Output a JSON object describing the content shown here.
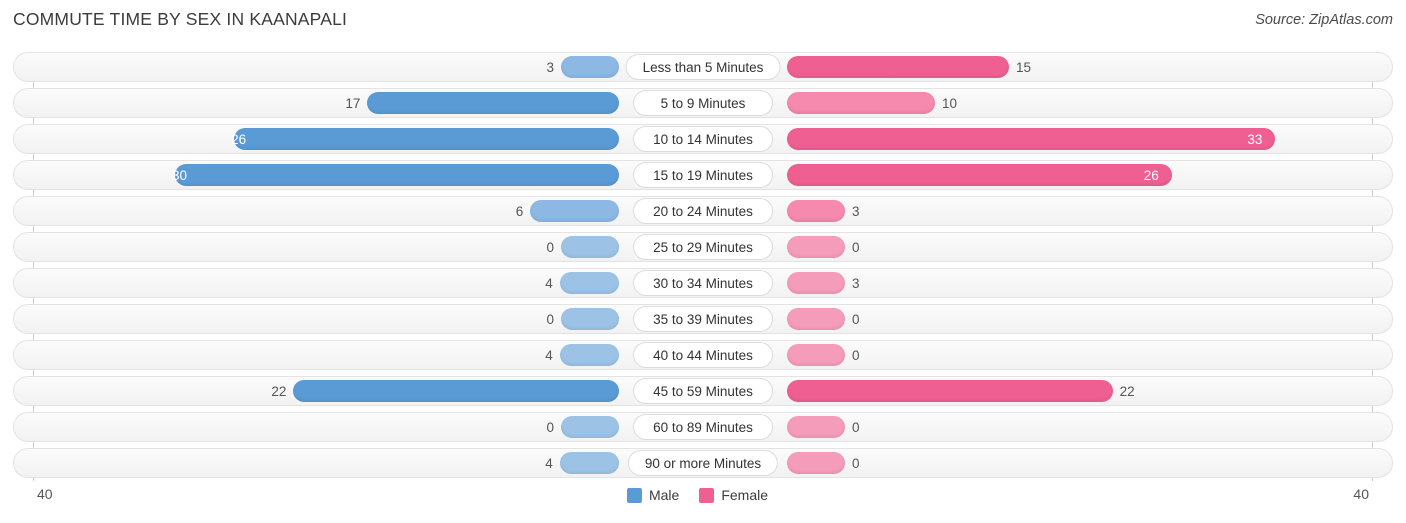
{
  "header": {
    "title": "COMMUTE TIME BY SEX IN KAANAPALI",
    "source": "Source: ZipAtlas.com"
  },
  "axis": {
    "left_label": "40",
    "right_label": "40",
    "max": 40
  },
  "legend": {
    "items": [
      {
        "label": "Male",
        "color": "#5b9bd5"
      },
      {
        "label": "Female",
        "color": "#ef5f92"
      }
    ]
  },
  "chart_data": {
    "type": "bar",
    "orientation": "horizontal-diverging",
    "title": "COMMUTE TIME BY SEX IN KAANAPALI",
    "xlabel": "",
    "ylabel": "",
    "xlim": [
      40,
      40
    ],
    "grid": false,
    "legend_position": "bottom-center",
    "categories": [
      "Less than 5 Minutes",
      "5 to 9 Minutes",
      "10 to 14 Minutes",
      "15 to 19 Minutes",
      "20 to 24 Minutes",
      "25 to 29 Minutes",
      "30 to 34 Minutes",
      "35 to 39 Minutes",
      "40 to 44 Minutes",
      "45 to 59 Minutes",
      "60 to 89 Minutes",
      "90 or more Minutes"
    ],
    "series": [
      {
        "name": "Male",
        "color": "#5b9bd5",
        "values": [
          3,
          17,
          26,
          30,
          6,
          0,
          4,
          0,
          4,
          22,
          0,
          4
        ]
      },
      {
        "name": "Female",
        "color": "#ef5f92",
        "values": [
          15,
          10,
          33,
          26,
          3,
          0,
          3,
          0,
          0,
          22,
          0,
          0
        ]
      }
    ]
  },
  "rows": [
    {
      "category": "Less than 5 Minutes",
      "male": "3",
      "female": "15",
      "male_val": 3,
      "female_val": 15,
      "male_shade": "mid",
      "female_shade": "sat",
      "male_inside": false,
      "female_inside": false
    },
    {
      "category": "5 to 9 Minutes",
      "male": "17",
      "female": "10",
      "male_val": 17,
      "female_val": 10,
      "male_shade": "sat",
      "female_shade": "mid",
      "male_inside": false,
      "female_inside": false
    },
    {
      "category": "10 to 14 Minutes",
      "male": "26",
      "female": "33",
      "male_val": 26,
      "female_val": 33,
      "male_shade": "sat",
      "female_shade": "sat",
      "male_inside": true,
      "female_inside": true
    },
    {
      "category": "15 to 19 Minutes",
      "male": "30",
      "female": "26",
      "male_val": 30,
      "female_val": 26,
      "male_shade": "sat",
      "female_shade": "sat",
      "male_inside": true,
      "female_inside": true
    },
    {
      "category": "20 to 24 Minutes",
      "male": "6",
      "female": "3",
      "male_val": 6,
      "female_val": 3,
      "male_shade": "mid",
      "female_shade": "mid",
      "male_inside": false,
      "female_inside": false
    },
    {
      "category": "25 to 29 Minutes",
      "male": "0",
      "female": "0",
      "male_val": 0,
      "female_val": 0,
      "male_shade": "pale",
      "female_shade": "pale",
      "male_inside": false,
      "female_inside": false
    },
    {
      "category": "30 to 34 Minutes",
      "male": "4",
      "female": "3",
      "male_val": 4,
      "female_val": 3,
      "male_shade": "pale",
      "female_shade": "pale",
      "male_inside": false,
      "female_inside": false
    },
    {
      "category": "35 to 39 Minutes",
      "male": "0",
      "female": "0",
      "male_val": 0,
      "female_val": 0,
      "male_shade": "pale",
      "female_shade": "pale",
      "male_inside": false,
      "female_inside": false
    },
    {
      "category": "40 to 44 Minutes",
      "male": "4",
      "female": "0",
      "male_val": 4,
      "female_val": 0,
      "male_shade": "pale",
      "female_shade": "pale",
      "male_inside": false,
      "female_inside": false
    },
    {
      "category": "45 to 59 Minutes",
      "male": "22",
      "female": "22",
      "male_val": 22,
      "female_val": 22,
      "male_shade": "sat",
      "female_shade": "sat",
      "male_inside": false,
      "female_inside": false
    },
    {
      "category": "60 to 89 Minutes",
      "male": "0",
      "female": "0",
      "male_val": 0,
      "female_val": 0,
      "male_shade": "pale",
      "female_shade": "pale",
      "male_inside": false,
      "female_inside": false
    },
    {
      "category": "90 or more Minutes",
      "male": "4",
      "female": "0",
      "male_val": 4,
      "female_val": 0,
      "male_shade": "pale",
      "female_shade": "pale",
      "male_inside": false,
      "female_inside": false
    }
  ]
}
